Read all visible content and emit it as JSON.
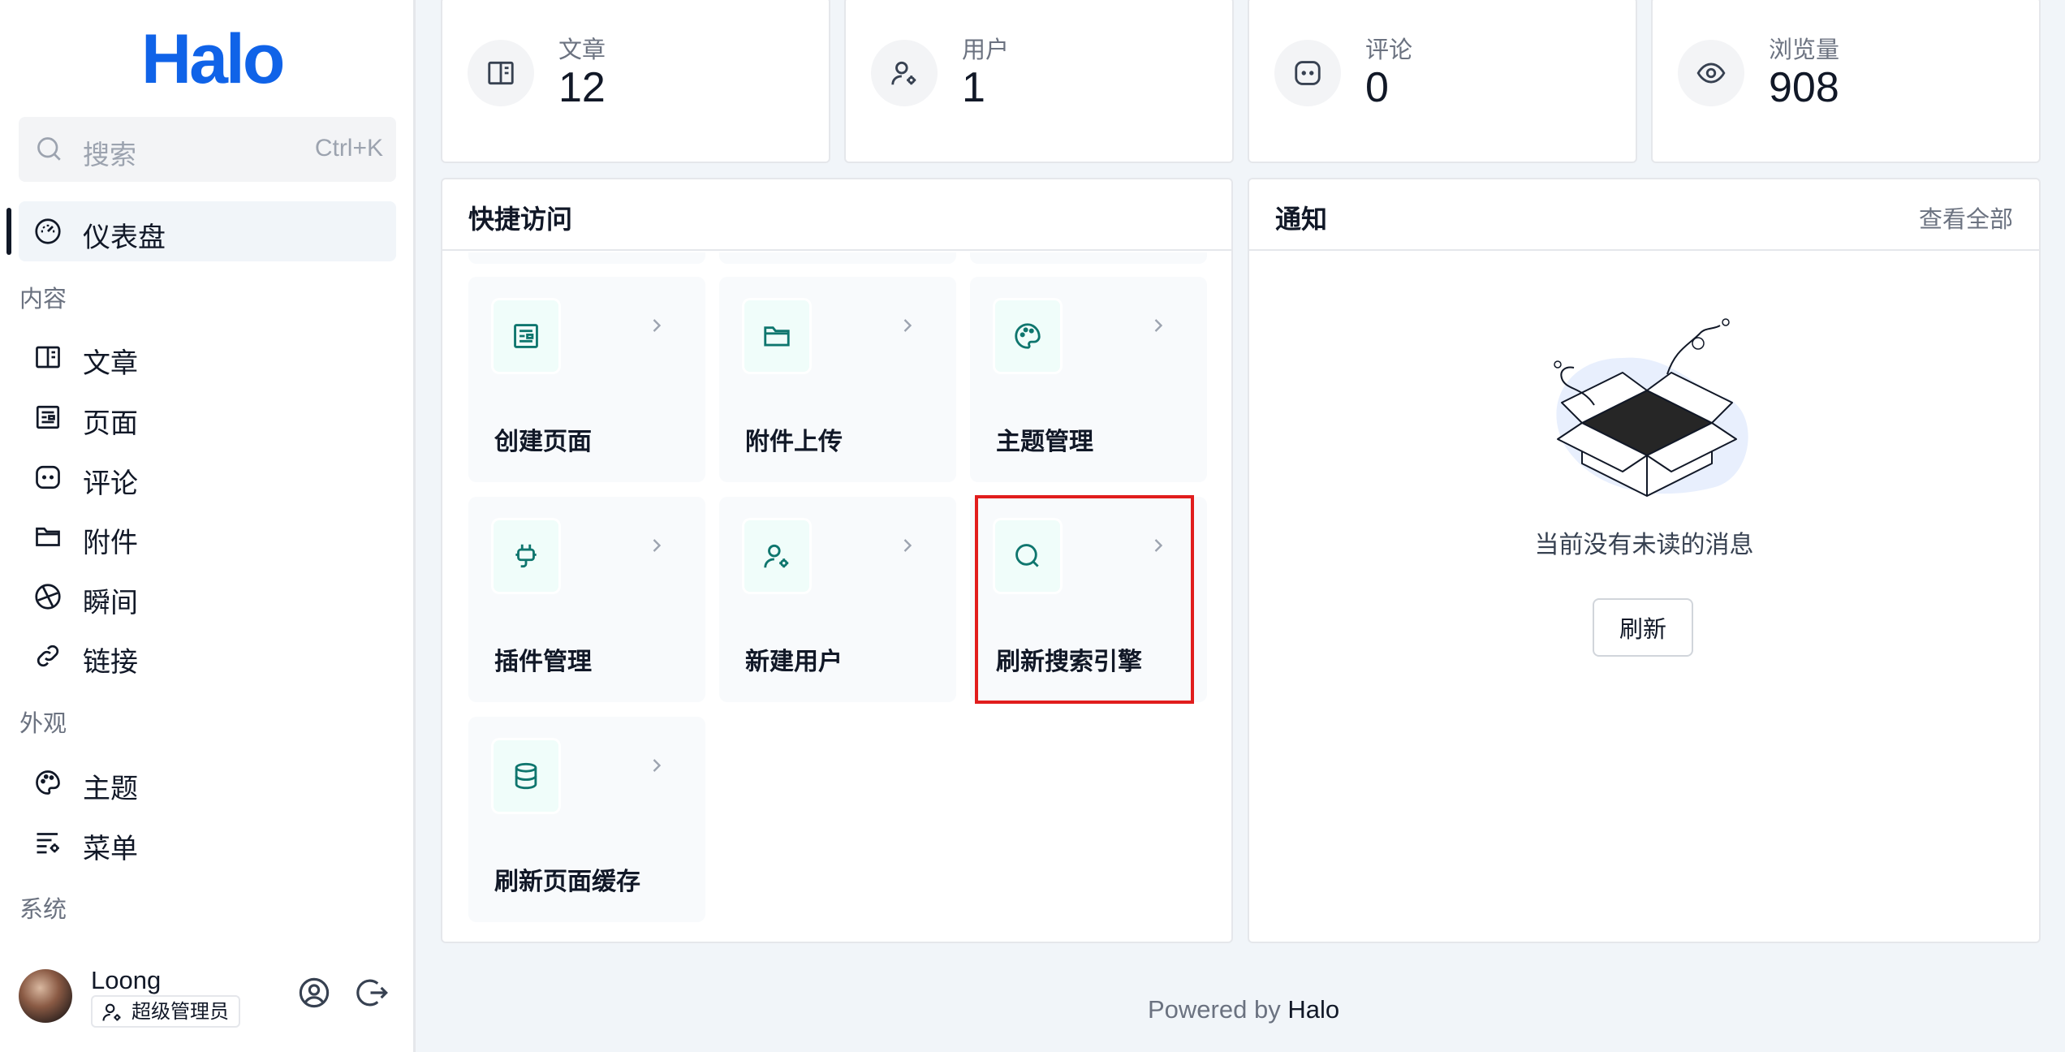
{
  "sidebar": {
    "logo": "Halo",
    "search": {
      "placeholder": "搜索",
      "shortcut": "Ctrl+K"
    },
    "dashboard": "仪表盘",
    "groups": {
      "content": "内容",
      "appearance": "外观",
      "system": "系统"
    },
    "content_items": [
      "文章",
      "页面",
      "评论",
      "附件",
      "瞬间",
      "链接"
    ],
    "appearance_items": [
      "主题",
      "菜单"
    ],
    "user": {
      "name": "Loong",
      "role": "超级管理员"
    }
  },
  "stats": [
    {
      "label": "文章",
      "value": "12",
      "icon": "book-icon"
    },
    {
      "label": "用户",
      "value": "1",
      "icon": "user-gear-icon"
    },
    {
      "label": "评论",
      "value": "0",
      "icon": "comment-icon"
    },
    {
      "label": "浏览量",
      "value": "908",
      "icon": "eye-icon"
    }
  ],
  "quick_access": {
    "title": "快捷访问",
    "tiles": [
      {
        "label": "创建页面",
        "icon": "page-icon"
      },
      {
        "label": "附件上传",
        "icon": "folder-icon"
      },
      {
        "label": "主题管理",
        "icon": "palette-icon"
      },
      {
        "label": "插件管理",
        "icon": "plug-icon"
      },
      {
        "label": "新建用户",
        "icon": "user-gear-icon"
      },
      {
        "label": "刷新搜索引擎",
        "icon": "search-icon"
      },
      {
        "label": "刷新页面缓存",
        "icon": "database-icon"
      }
    ]
  },
  "notifications": {
    "title": "通知",
    "view_all": "查看全部",
    "empty_text": "当前没有未读的消息",
    "refresh": "刷新"
  },
  "footer": {
    "prefix": "Powered by",
    "brand": "Halo"
  },
  "colors": {
    "brand": "#1063e8",
    "accent_teal": "#0f766e",
    "highlight": "#e11d1d"
  }
}
